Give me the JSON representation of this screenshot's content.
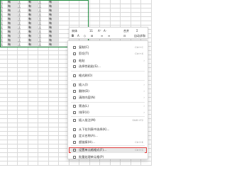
{
  "sheet": {
    "rows": [
      [
        "王",
        "有",
        "王",
        "有",
        "王",
        "有"
      ],
      [
        "王",
        "有",
        "王",
        "有",
        "王",
        "有"
      ],
      [
        "王",
        "有",
        "王",
        "有",
        "王",
        "有"
      ],
      [
        "王",
        "有",
        "王",
        "有",
        "王",
        "有"
      ],
      [
        "王",
        "有",
        "王",
        "有",
        "王",
        "有"
      ],
      [
        "王",
        "有",
        "王",
        "有",
        "王",
        "有"
      ],
      [
        "王",
        "有",
        "王",
        "有",
        "王",
        "有"
      ],
      [
        "王",
        "有",
        "王",
        "有",
        "王",
        "有"
      ],
      [
        "王",
        "有",
        "王",
        "有",
        "王",
        "有"
      ],
      [
        "王",
        "有",
        "王",
        "有",
        "王",
        "有"
      ],
      [
        "王",
        "有",
        "王",
        "有",
        "王",
        "有"
      ]
    ]
  },
  "toolbar": {
    "font_name": "宋体",
    "font_size": "11",
    "grow_font": "A⁺",
    "shrink_font": "A⁻",
    "merge": "合并",
    "sum": "自动求和",
    "bold": "B",
    "sum_symbol": "Σ"
  },
  "menu": {
    "items": [
      {
        "label": "复制(C)",
        "shortcut": "Ctrl+C"
      },
      {
        "label": "剪切(T)",
        "shortcut": "Ctrl+X"
      },
      {
        "label": "粘贴",
        "shortcut": ""
      },
      {
        "label": "选择性粘贴(S)...",
        "shortcut": ""
      },
      {
        "label": "格式刷(O)",
        "shortcut": ""
      },
      {
        "label": "插入(I)",
        "shortcut": ""
      },
      {
        "label": "删除(D)",
        "shortcut": ""
      },
      {
        "label": "清除内容(N)",
        "shortcut": ""
      },
      {
        "label": "筛选(L)",
        "shortcut": ""
      },
      {
        "label": "排序(U)",
        "shortcut": ""
      },
      {
        "label": "插入批注(M)",
        "shortcut": "Shift+F2"
      },
      {
        "label": "从下拉列表中选择(K)...",
        "shortcut": ""
      },
      {
        "label": "定义名称(A)...",
        "shortcut": ""
      },
      {
        "label": "超链接(H)...",
        "shortcut": "Ctrl+K"
      },
      {
        "label": "设置单元格格式(F)...",
        "shortcut": "Ctrl+1"
      },
      {
        "label": "批量处理单元格(P)",
        "shortcut": ""
      }
    ]
  },
  "colors": {
    "selection_border": "#1e8a3e",
    "highlight_border": "#e03a3a"
  }
}
